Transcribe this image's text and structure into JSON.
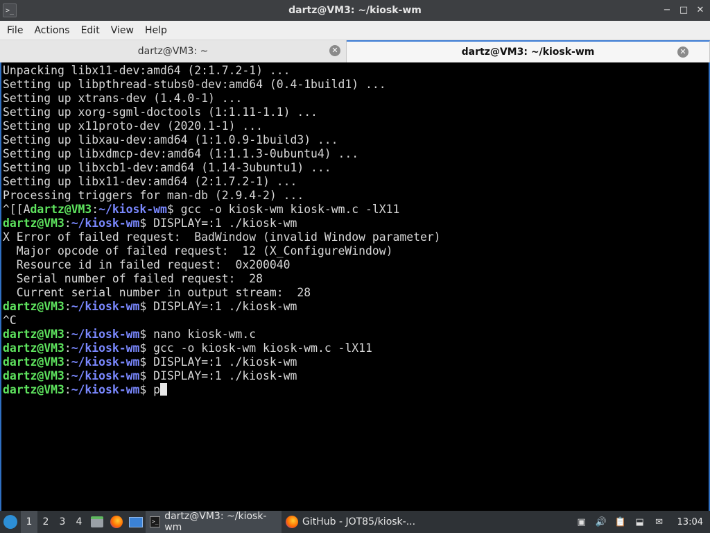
{
  "window": {
    "title": "dartz@VM3: ~/kiosk-wm",
    "controls": {
      "minimize": "−",
      "maximize": "□",
      "close": "✕"
    },
    "app_icon": "terminal-icon"
  },
  "menu": [
    "File",
    "Actions",
    "Edit",
    "View",
    "Help"
  ],
  "tabs": [
    {
      "label": "dartz@VM3: ~",
      "active": false
    },
    {
      "label": "dartz@VM3: ~/kiosk-wm",
      "active": true
    }
  ],
  "terminal": {
    "output_lines": [
      "Unpacking libx11-dev:amd64 (2:1.7.2-1) ...",
      "Setting up libpthread-stubs0-dev:amd64 (0.4-1build1) ...",
      "Setting up xtrans-dev (1.4.0-1) ...",
      "Setting up xorg-sgml-doctools (1:1.11-1.1) ...",
      "Setting up x11proto-dev (2020.1-1) ...",
      "Setting up libxau-dev:amd64 (1:1.0.9-1build3) ...",
      "Setting up libxdmcp-dev:amd64 (1:1.1.3-0ubuntu4) ...",
      "Setting up libxcb1-dev:amd64 (1.14-3ubuntu1) ...",
      "Setting up libx11-dev:amd64 (2:1.7.2-1) ...",
      "Processing triggers for man-db (2.9.4-2) ..."
    ],
    "escape_prefix": "^[[A",
    "user_host": "dartz@VM3",
    "path": "~/kiosk-wm",
    "cmd_gcc": "gcc -o kiosk-wm kiosk-wm.c -lX11",
    "cmd_run": "DISPLAY=:1 ./kiosk-wm",
    "error_lines": [
      "X Error of failed request:  BadWindow (invalid Window parameter)",
      "  Major opcode of failed request:  12 (X_ConfigureWindow)",
      "  Resource id in failed request:  0x200040",
      "  Serial number of failed request:  28",
      "  Current serial number in output stream:  28"
    ],
    "interrupt": "^C",
    "cmd_nano": "nano kiosk-wm.c",
    "current_input": "p"
  },
  "taskbar": {
    "workspaces": [
      "1",
      "2",
      "3",
      "4"
    ],
    "active_workspace": "1",
    "tasks": [
      {
        "label": "dartz@VM3: ~/kiosk-wm",
        "icon": "terminal-icon",
        "active": true
      },
      {
        "label": "GitHub - JOT85/kiosk-...",
        "icon": "firefox-icon",
        "active": false
      }
    ],
    "clock": "13:04"
  }
}
